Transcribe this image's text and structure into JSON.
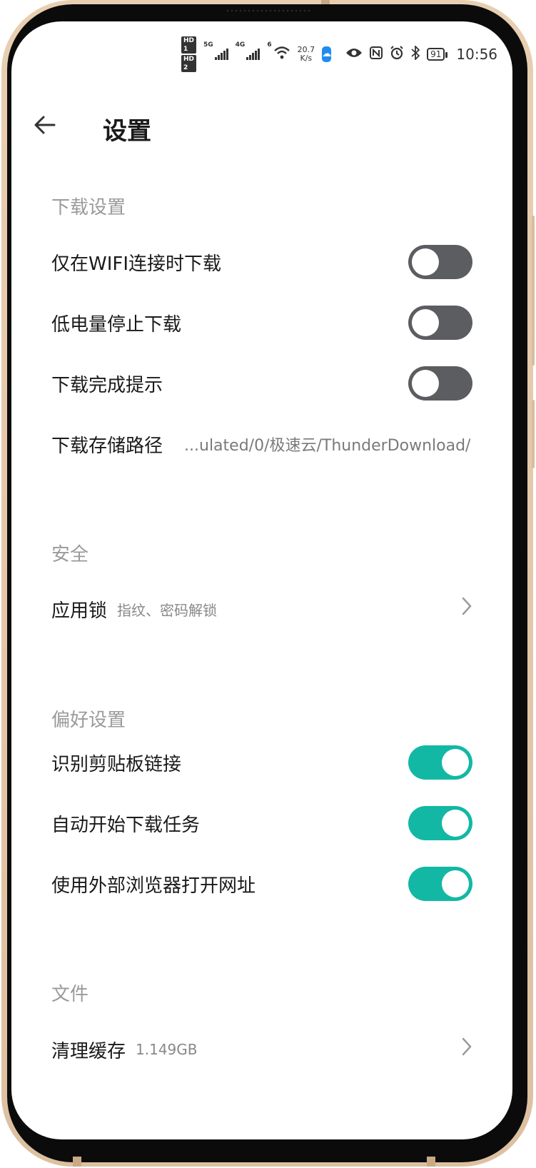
{
  "status_bar": {
    "hd1": "HD 1",
    "hd2": "HD 2",
    "net1": "5G",
    "net2": "4G",
    "wifi_level": "6",
    "speed_value": "20.7",
    "speed_unit": "K/s",
    "battery": "91",
    "time": "10:56"
  },
  "header": {
    "back_icon": "arrow-left-icon",
    "title": "设置"
  },
  "sections": {
    "download": {
      "title": "下载设置",
      "wifi_only": {
        "label": "仅在WIFI连接时下载",
        "enabled": false
      },
      "low_battery": {
        "label": "低电量停止下载",
        "enabled": false
      },
      "complete_notice": {
        "label": "下载完成提示",
        "enabled": false
      },
      "storage_path": {
        "label": "下载存储路径",
        "value": "...ulated/0/极速云/ThunderDownload/"
      }
    },
    "security": {
      "title": "安全",
      "app_lock": {
        "label": "应用锁",
        "sub": "指纹、密码解锁"
      }
    },
    "preferences": {
      "title": "偏好设置",
      "clipboard": {
        "label": "识别剪贴板链接",
        "enabled": true
      },
      "auto_start": {
        "label": "自动开始下载任务",
        "enabled": true
      },
      "external_browser": {
        "label": "使用外部浏览器打开网址",
        "enabled": true
      }
    },
    "files": {
      "title": "文件",
      "clear_cache": {
        "label": "清理缓存",
        "sub": "1.149GB"
      }
    }
  },
  "colors": {
    "toggle_on": "#12b8a4",
    "toggle_off": "#5b5d60"
  }
}
